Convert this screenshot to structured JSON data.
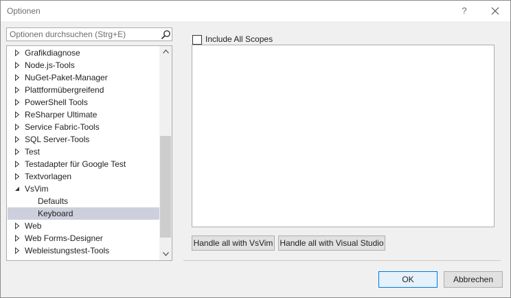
{
  "window": {
    "title": "Optionen",
    "help_label": "?"
  },
  "search": {
    "placeholder": "Optionen durchsuchen (Strg+E)"
  },
  "tree": {
    "items": [
      {
        "label": "Grafikdiagnose",
        "state": "collapsed"
      },
      {
        "label": "Node.js-Tools",
        "state": "collapsed"
      },
      {
        "label": "NuGet-Paket-Manager",
        "state": "collapsed"
      },
      {
        "label": "Plattformübergreifend",
        "state": "collapsed"
      },
      {
        "label": "PowerShell Tools",
        "state": "collapsed"
      },
      {
        "label": "ReSharper Ultimate",
        "state": "collapsed"
      },
      {
        "label": "Service Fabric-Tools",
        "state": "collapsed"
      },
      {
        "label": "SQL Server-Tools",
        "state": "collapsed"
      },
      {
        "label": "Test",
        "state": "collapsed"
      },
      {
        "label": "Testadapter für Google Test",
        "state": "collapsed"
      },
      {
        "label": "Textvorlagen",
        "state": "collapsed"
      },
      {
        "label": "VsVim",
        "state": "expanded"
      },
      {
        "label": "Defaults",
        "state": "child"
      },
      {
        "label": "Keyboard",
        "state": "child-selected"
      },
      {
        "label": "Web",
        "state": "collapsed"
      },
      {
        "label": "Web Forms-Designer",
        "state": "collapsed"
      },
      {
        "label": "Webleistungstest-Tools",
        "state": "collapsed"
      }
    ]
  },
  "right": {
    "include_all_scopes_label": "Include All Scopes",
    "include_all_scopes_checked": false,
    "handle_vsvim_label": "Handle all with VsVim",
    "handle_vs_label": "Handle all with Visual Studio"
  },
  "footer": {
    "ok_label": "OK",
    "cancel_label": "Abbrechen"
  },
  "colors": {
    "selection": "#cdd0dc",
    "accent": "#0078d7",
    "dialog_bg": "#f0f0f0"
  },
  "icons": {
    "search": "magnifier-icon",
    "close": "close-icon",
    "collapsed": "triangle-right-icon",
    "expanded": "triangle-down-icon",
    "scroll_up": "chevron-up-icon",
    "scroll_down": "chevron-down-icon"
  }
}
